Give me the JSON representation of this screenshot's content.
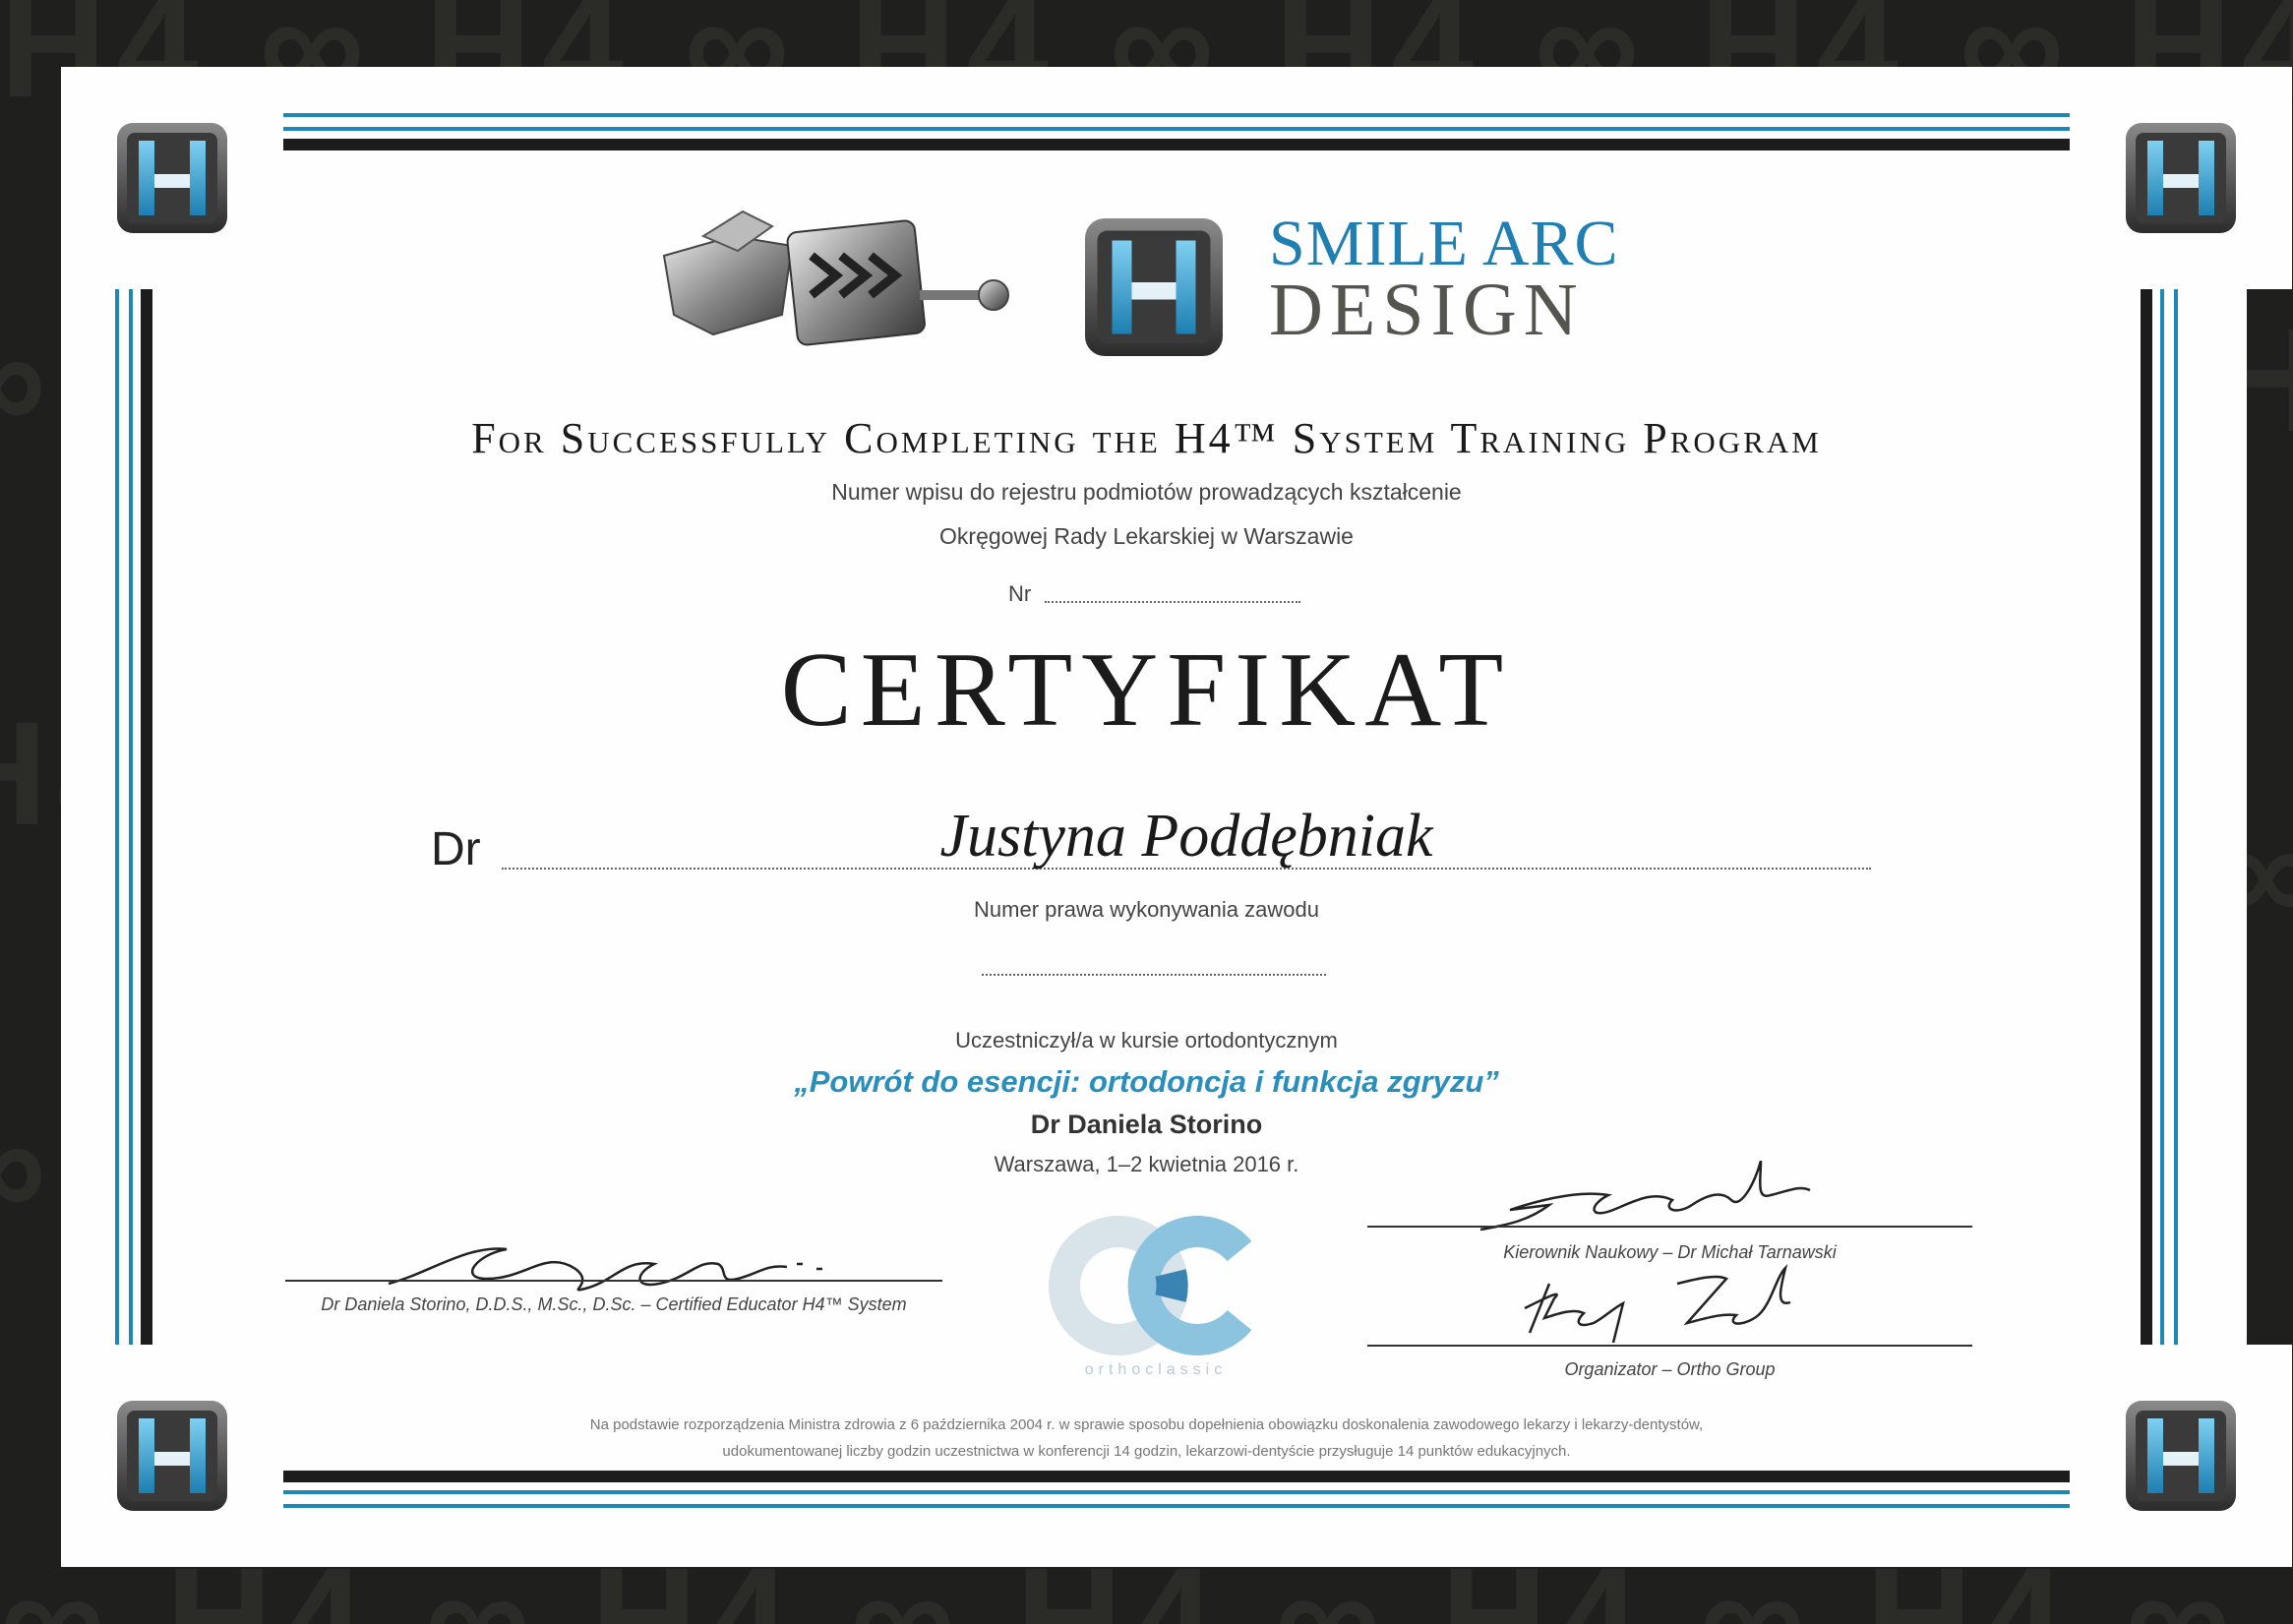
{
  "brand": {
    "name_line1": "SMILE ARC",
    "name_line2": "DESIGN",
    "color_blue": "#1f7fb2",
    "color_gray": "#5a5a55"
  },
  "header": {
    "program": "For Successfully Completing the H4™ System Training Program",
    "registry_line1": "Numer wpisu do rejestru podmiotów prowadzących kształcenie",
    "registry_line2": "Okręgowej Rady Lekarskiej w Warszawie",
    "nr_label": "Nr"
  },
  "title": "CERTYFIKAT",
  "recipient": {
    "prefix": "Dr",
    "name": "Justyna Poddębniak",
    "license_label": "Numer prawa wykonywania zawodu"
  },
  "course": {
    "participated": "Uczestniczył/a w kursie ortodontycznym",
    "title": "„Powrót do esencji: ortodoncja i funkcja zgryzu”",
    "lecturer": "Dr Daniela Storino",
    "place_date": "Warszawa, 1–2 kwietnia 2016 r."
  },
  "signatures": {
    "left_caption": "Dr Daniela Storino, D.D.S., M.Sc., D.Sc. – Certified Educator H4™ System",
    "right_top_caption": "Kierownik Naukowy – Dr Michał Tarnawski",
    "right_bottom_caption": "Organizator – Ortho Group"
  },
  "ortho_logo": {
    "text": "orthoclassic"
  },
  "footer": {
    "line1": "Na podstawie rozporządzenia Ministra zdrowia z 6 października 2004 r. w sprawie sposobu dopełnienia obowiązku doskonalenia zawodowego lekarzy i lekarzy-dentystów,",
    "line2": "udokumentowanej liczby godzin uczestnictwa w konferencji 14 godzin, lekarzowi-dentyście przysługuje 14 punktów edukacyjnych."
  }
}
